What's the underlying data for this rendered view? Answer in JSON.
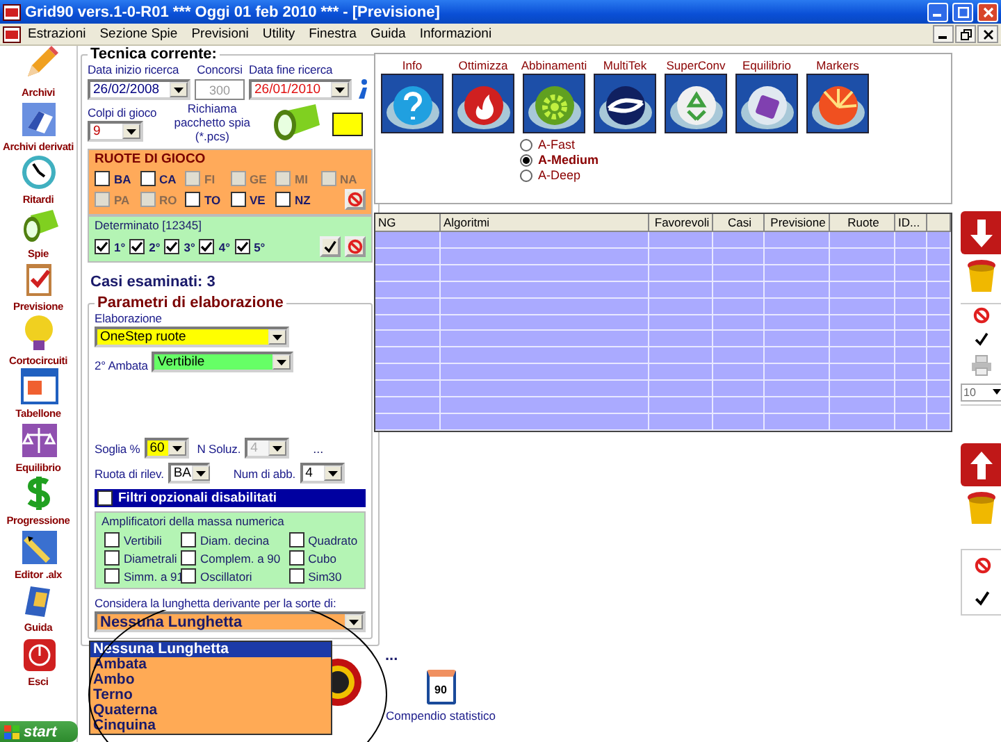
{
  "window": {
    "title": "Grid90 vers.1-0-R01 *** Oggi 01 feb 2010 *** - [Previsione]"
  },
  "menu": [
    "Estrazioni",
    "Sezione Spie",
    "Previsioni",
    "Utility",
    "Finestra",
    "Guida",
    "Informazioni"
  ],
  "sidebar": [
    "Archivi",
    "Archivi derivati",
    "Ritardi",
    "Spie",
    "Previsione",
    "Cortocircuiti",
    "Tabellone",
    "Equilibrio",
    "Progressione",
    "Editor .alx",
    "Guida",
    "Esci"
  ],
  "tecnica": {
    "title": "Tecnica corrente:",
    "start_label": "Data inizio ricerca",
    "start_value": "26/02/2008",
    "concorsi_label": "Concorsi",
    "concorsi_value": "300",
    "end_label": "Data fine ricerca",
    "end_value": "26/01/2010",
    "colpi_label": "Colpi di gioco",
    "colpi_value": "9",
    "richiama_label": "Richiama pacchetto spia (*.pcs)"
  },
  "ruote": {
    "title": "RUOTE DI GIOCO",
    "items": [
      {
        "label": "BA",
        "checked": false,
        "disabled": false
      },
      {
        "label": "CA",
        "checked": false,
        "disabled": false
      },
      {
        "label": "FI",
        "checked": false,
        "disabled": true
      },
      {
        "label": "GE",
        "checked": false,
        "disabled": true
      },
      {
        "label": "MI",
        "checked": false,
        "disabled": true
      },
      {
        "label": "NA",
        "checked": false,
        "disabled": true
      },
      {
        "label": "PA",
        "checked": false,
        "disabled": true
      },
      {
        "label": "RO",
        "checked": false,
        "disabled": true
      },
      {
        "label": "TO",
        "checked": false,
        "disabled": false
      },
      {
        "label": "VE",
        "checked": false,
        "disabled": false
      },
      {
        "label": "NZ",
        "checked": false,
        "disabled": false
      }
    ]
  },
  "determinato": {
    "title": "Determinato [12345]",
    "items": [
      {
        "label": "1°",
        "checked": true
      },
      {
        "label": "2°",
        "checked": true
      },
      {
        "label": "3°",
        "checked": true
      },
      {
        "label": "4°",
        "checked": true
      },
      {
        "label": "5°",
        "checked": true
      }
    ]
  },
  "casi": "Casi esaminati: 3",
  "parametri": {
    "title": "Parametri di elaborazione",
    "elaborazione_label": "Elaborazione",
    "elaborazione_value": "OneStep ruote",
    "ambata_label": "2° Ambata",
    "ambata_value": "Vertibile",
    "soglia_label": "Soglia %",
    "soglia_value": "60",
    "nsoluz_label": "N Soluz.",
    "nsoluz_value": "4",
    "nsoluz_disabled": true,
    "more": "...",
    "ruota_label": "Ruota di rilev.",
    "ruota_value": "BA",
    "num_label": "Num di abb.",
    "num_value": "4",
    "filtri": {
      "label": "Filtri opzionali disabilitati",
      "checked": false
    },
    "amplificatori": {
      "title": "Amplificatori della massa numerica",
      "items": [
        {
          "label": "Vertibili",
          "checked": false
        },
        {
          "label": "Diam. decina",
          "checked": false
        },
        {
          "label": "Quadrato",
          "checked": false
        },
        {
          "label": "Diametrali",
          "checked": false
        },
        {
          "label": "Complem. a 90",
          "checked": false
        },
        {
          "label": "Cubo",
          "checked": false
        },
        {
          "label": "Simm. a 91",
          "checked": false
        },
        {
          "label": "Oscillatori",
          "checked": false
        },
        {
          "label": "Sim30",
          "checked": false
        }
      ]
    },
    "lunghetta_label": "Considera la lunghetta derivante per la sorte di:",
    "lunghetta_value": "Nessuna Lunghetta"
  },
  "lunghetta_options": [
    {
      "label": "Nessuna Lunghetta",
      "selected": true
    },
    {
      "label": "Ambata",
      "selected": false
    },
    {
      "label": "Ambo",
      "selected": false
    },
    {
      "label": "Terno",
      "selected": false
    },
    {
      "label": "Quaterna",
      "selected": false
    },
    {
      "label": "Cinquina",
      "selected": false
    }
  ],
  "tools": [
    "Info",
    "Ottimizza",
    "Abbinamenti",
    "MultiTek",
    "SuperConv",
    "Equilibrio",
    "Markers"
  ],
  "algo_modes": [
    {
      "label": "A-Fast",
      "selected": false
    },
    {
      "label": "A-Medium",
      "selected": true
    },
    {
      "label": "A-Deep",
      "selected": false
    }
  ],
  "table": {
    "columns": [
      "NG",
      "Algoritmi",
      "Favorevoli",
      "Casi",
      "Previsione",
      "Ruote",
      "ID..."
    ]
  },
  "page_size": "10",
  "more": "...",
  "compendio": {
    "label": "Compendio statistico",
    "badge": "90"
  },
  "start": "start"
}
